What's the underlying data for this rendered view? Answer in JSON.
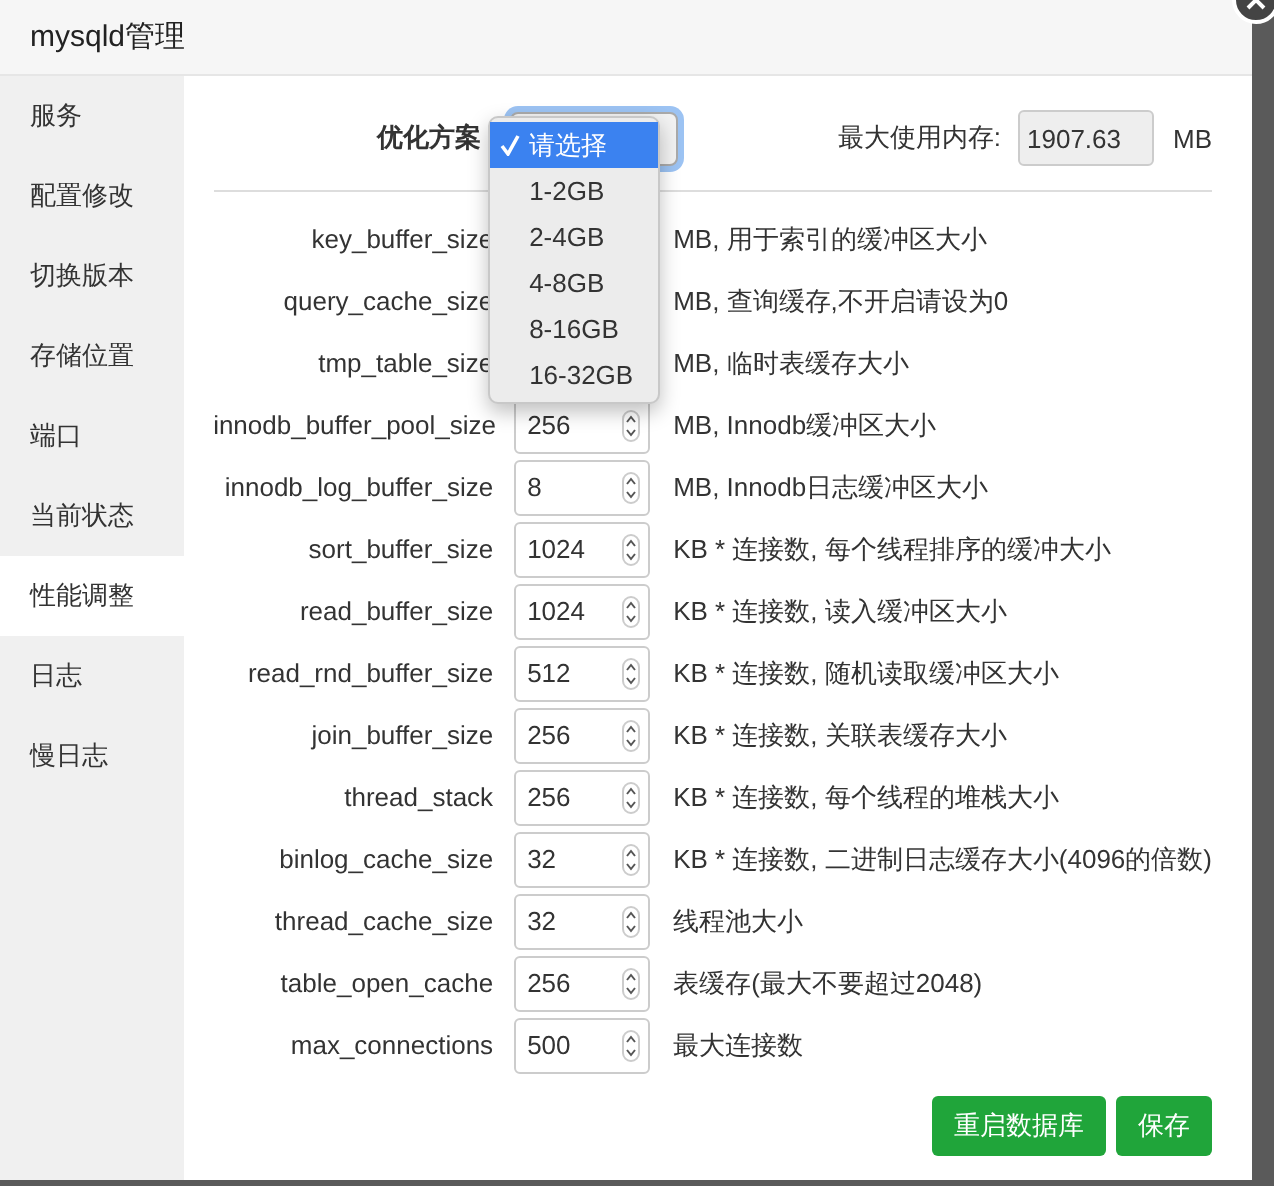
{
  "window": {
    "title": "mysqld管理"
  },
  "sidebar": {
    "items": [
      {
        "label": "服务",
        "selected": false
      },
      {
        "label": "配置修改",
        "selected": false
      },
      {
        "label": "切换版本",
        "selected": false
      },
      {
        "label": "存储位置",
        "selected": false
      },
      {
        "label": "端口",
        "selected": false
      },
      {
        "label": "当前状态",
        "selected": false
      },
      {
        "label": "性能调整",
        "selected": true
      },
      {
        "label": "日志",
        "selected": false
      },
      {
        "label": "慢日志",
        "selected": false
      }
    ]
  },
  "plan": {
    "label": "优化方案",
    "options": [
      {
        "label": "请选择",
        "selected": true
      },
      {
        "label": "1-2GB",
        "selected": false
      },
      {
        "label": "2-4GB",
        "selected": false
      },
      {
        "label": "4-8GB",
        "selected": false
      },
      {
        "label": "8-16GB",
        "selected": false
      },
      {
        "label": "16-32GB",
        "selected": false
      }
    ]
  },
  "memory": {
    "label": "最大使用内存:",
    "value": "1907.63",
    "unit": "MB"
  },
  "settings": [
    {
      "name": "key_buffer_size",
      "note": "MB, 用于索引的缓冲区大小"
    },
    {
      "name": "query_cache_size",
      "note": "MB, 查询缓存,不开启请设为0"
    },
    {
      "name": "tmp_table_size",
      "note": "MB, 临时表缓存大小"
    },
    {
      "name": "innodb_buffer_pool_size",
      "value": "256",
      "note": "MB, Innodb缓冲区大小"
    },
    {
      "name": "innodb_log_buffer_size",
      "value": "8",
      "note": "MB, Innodb日志缓冲区大小"
    },
    {
      "name": "sort_buffer_size",
      "value": "1024",
      "note": "KB * 连接数, 每个线程排序的缓冲大小"
    },
    {
      "name": "read_buffer_size",
      "value": "1024",
      "note": "KB * 连接数, 读入缓冲区大小"
    },
    {
      "name": "read_rnd_buffer_size",
      "value": "512",
      "note": "KB * 连接数, 随机读取缓冲区大小"
    },
    {
      "name": "join_buffer_size",
      "value": "256",
      "note": "KB * 连接数, 关联表缓存大小"
    },
    {
      "name": "thread_stack",
      "value": "256",
      "note": "KB * 连接数, 每个线程的堆栈大小"
    },
    {
      "name": "binlog_cache_size",
      "value": "32",
      "note": "KB * 连接数, 二进制日志缓存大小(4096的倍数)"
    },
    {
      "name": "thread_cache_size",
      "value": "32",
      "note": "线程池大小"
    },
    {
      "name": "table_open_cache",
      "value": "256",
      "note": "表缓存(最大不要超过2048)"
    },
    {
      "name": "max_connections",
      "value": "500",
      "note": "最大连接数"
    }
  ],
  "buttons": [
    {
      "label": "重启数据库"
    },
    {
      "label": "保存"
    }
  ]
}
